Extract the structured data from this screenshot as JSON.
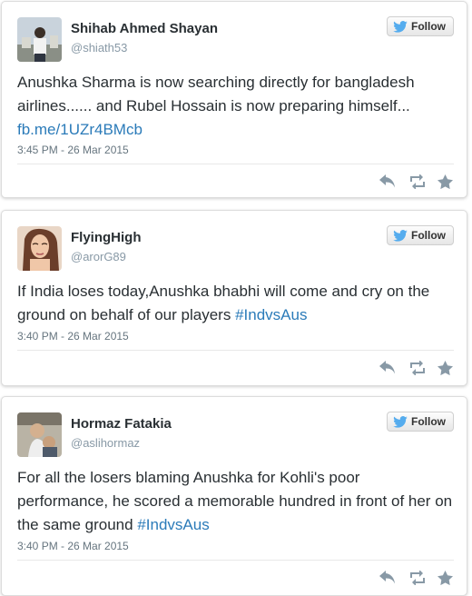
{
  "follow_label": "Follow",
  "colors": {
    "link": "#2b7bb9",
    "twitter_blue": "#55acee",
    "action_gray": "#8899a6"
  },
  "tweets": [
    {
      "name": "Shihab Ahmed Shayan",
      "handle": "@shiath53",
      "text_before": "Anushka Sharma is now searching directly for bangladesh airlines...... and Rubel Hossain is now preparing himself... ",
      "link": "fb.me/1UZr4BMcb",
      "timestamp": "3:45 PM - 26 Mar 2015"
    },
    {
      "name": "FlyingHigh",
      "handle": "@arorG89",
      "text_before": "If India loses today,Anushka bhabhi  will come and cry on the ground on behalf of our players ",
      "link": "#IndvsAus",
      "timestamp": "3:40 PM - 26 Mar 2015"
    },
    {
      "name": "Hormaz Fatakia",
      "handle": "@aslihormaz",
      "text_before": "For all the losers blaming Anushka for Kohli's poor performance, he scored a memorable hundred in front of her on the same ground ",
      "link": "#IndvsAus",
      "timestamp": "3:40 PM - 26 Mar 2015"
    }
  ],
  "icons": [
    "twitter-bird-icon",
    "reply-icon",
    "retweet-icon",
    "favorite-icon"
  ]
}
